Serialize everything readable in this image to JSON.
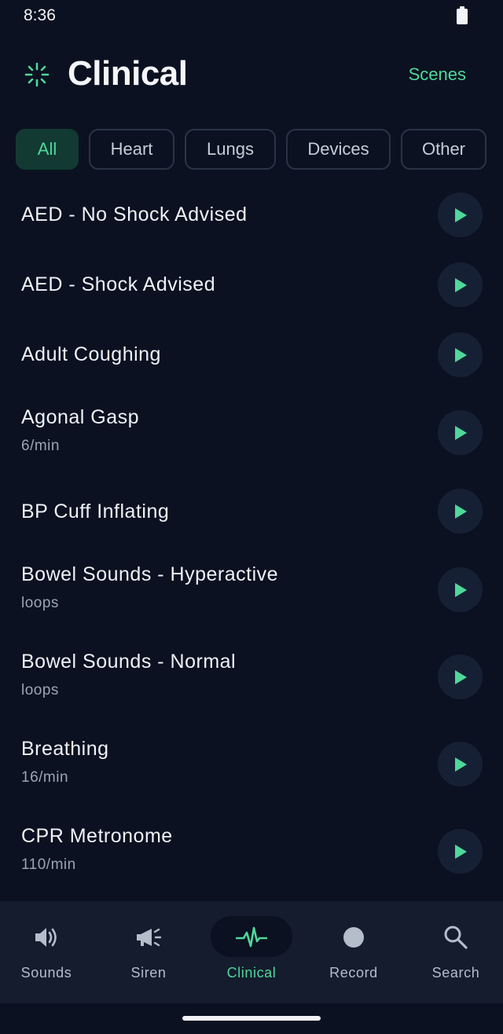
{
  "status": {
    "time": "8:36"
  },
  "header": {
    "title": "Clinical",
    "scenes_label": "Scenes"
  },
  "filters": [
    "All",
    "Heart",
    "Lungs",
    "Devices",
    "Other"
  ],
  "active_filter": "All",
  "sounds": [
    {
      "title": "AED - No Shock Advised",
      "subtitle": ""
    },
    {
      "title": "AED - Shock Advised",
      "subtitle": ""
    },
    {
      "title": "Adult Coughing",
      "subtitle": ""
    },
    {
      "title": "Agonal Gasp",
      "subtitle": "6/min"
    },
    {
      "title": "BP Cuff Inflating",
      "subtitle": ""
    },
    {
      "title": "Bowel Sounds - Hyperactive",
      "subtitle": "loops"
    },
    {
      "title": "Bowel Sounds - Normal",
      "subtitle": "loops"
    },
    {
      "title": "Breathing",
      "subtitle": "16/min"
    },
    {
      "title": "CPR Metronome",
      "subtitle": "110/min"
    }
  ],
  "nav": [
    {
      "label": "Sounds",
      "icon": "speaker-icon"
    },
    {
      "label": "Siren",
      "icon": "megaphone-icon"
    },
    {
      "label": "Clinical",
      "icon": "heartbeat-icon",
      "active": true
    },
    {
      "label": "Record",
      "icon": "record-icon"
    },
    {
      "label": "Search",
      "icon": "search-icon"
    }
  ],
  "colors": {
    "background": "#0b1120",
    "accent": "#4fd89a",
    "surface": "#141c2e",
    "play_button": "#162035"
  }
}
